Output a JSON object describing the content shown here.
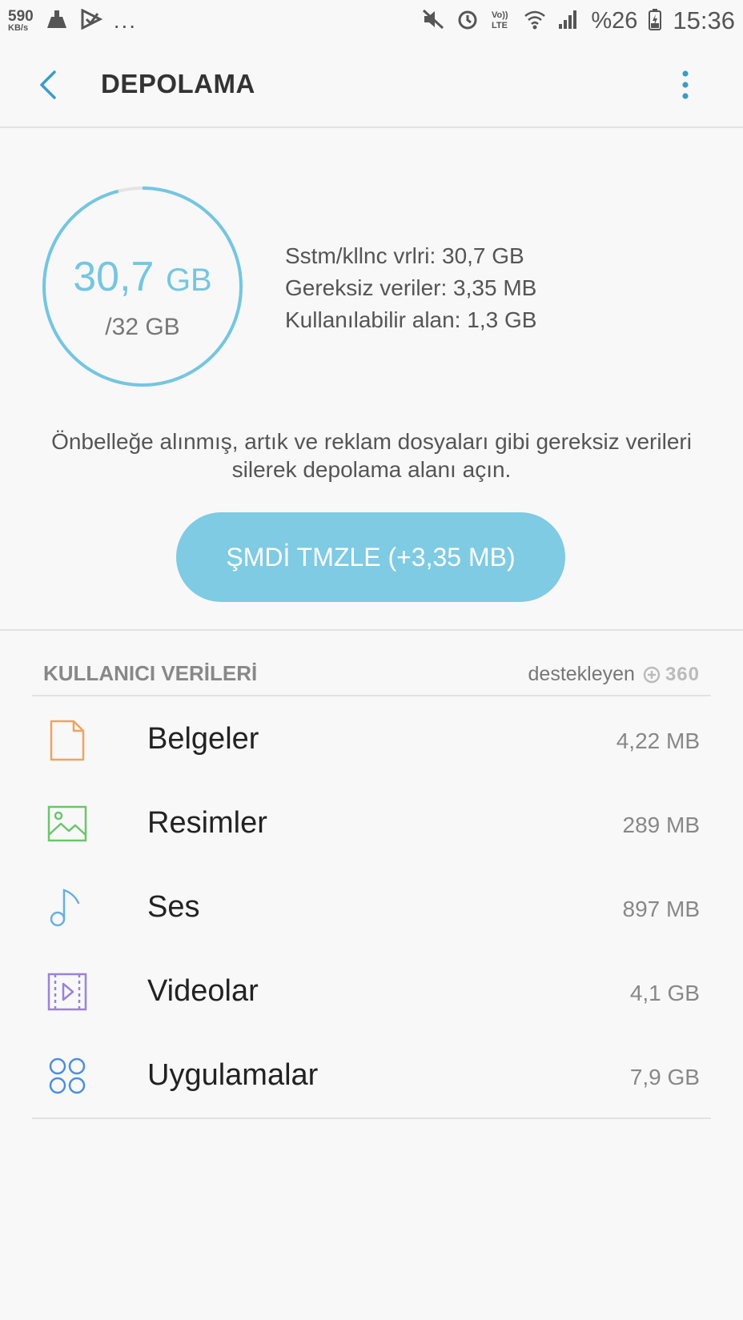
{
  "status_bar": {
    "net_speed": "590",
    "net_unit": "KB/s",
    "more": "...",
    "battery": "%26",
    "time": "15:36"
  },
  "app_bar": {
    "title": "DEPOLAMA"
  },
  "storage": {
    "used_value": "30,7",
    "used_unit": "GB",
    "total": "/32 GB",
    "used_fraction": 0.96,
    "stats": [
      "Sstm/kllnc vrlri: 30,7 GB",
      "Gereksiz veriler: 3,35 MB",
      "Kullanılabilir alan: 1,3 GB"
    ]
  },
  "cleanup": {
    "description": "Önbelleğe alınmış, artık ve reklam dosyaları gibi gereksiz verileri silerek depolama alanı açın.",
    "button_label": "ŞMDİ TMZLE (+3,35 MB)"
  },
  "user_data": {
    "header": "KULLANICI VERİLERİ",
    "powered_by": "destekleyen",
    "powered_brand": "360",
    "items": [
      {
        "label": "Belgeler",
        "size": "4,22 MB",
        "icon": "document-icon",
        "color": "#f0a35e"
      },
      {
        "label": "Resimler",
        "size": "289 MB",
        "icon": "image-icon",
        "color": "#6cc56c"
      },
      {
        "label": "Ses",
        "size": "897 MB",
        "icon": "music-note-icon",
        "color": "#6aaee0"
      },
      {
        "label": "Videolar",
        "size": "4,1 GB",
        "icon": "video-icon",
        "color": "#9a83d9"
      },
      {
        "label": "Uygulamalar",
        "size": "7,9 GB",
        "icon": "apps-icon",
        "color": "#4b8fdc"
      }
    ]
  },
  "colors": {
    "accent": "#7ecbe3",
    "ring": "#74c6e1",
    "ring_track": "#e4e4e4",
    "back_icon": "#3b9cc9"
  }
}
